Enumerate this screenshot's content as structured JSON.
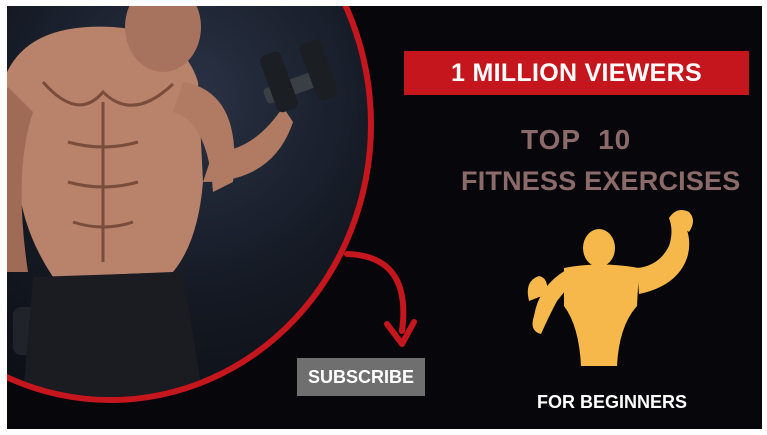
{
  "banner": {
    "text": "1 MILLION VIEWERS"
  },
  "headline": {
    "top": "TOP  10",
    "sub": "FITNESS EXERCISES"
  },
  "subscribe": {
    "label": "SUBSCRIBE"
  },
  "footer": {
    "text": "FOR BEGINNERS"
  },
  "icons": {
    "photo": "bodybuilder-dumbbell-photo",
    "silhouette": "flexing-muscle-man-icon",
    "arrow": "curved-arrow-icon"
  },
  "colors": {
    "background": "#07070b",
    "accent_red": "#c4161c",
    "headline": "#8b6a69",
    "silhouette": "#f6b84b",
    "button": "#6f6f6f"
  }
}
